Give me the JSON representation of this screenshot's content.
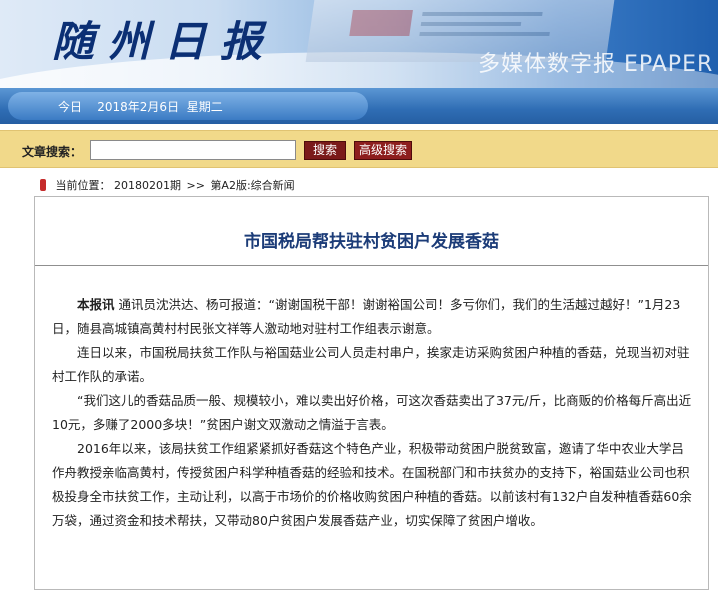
{
  "header": {
    "logo_text": "随州日报",
    "slogan": "多媒体数字报 EPAPER"
  },
  "datebar": {
    "date_text": "今日    2018年2月6日  星期二"
  },
  "search": {
    "label": "文章搜索：",
    "value": "",
    "placeholder": "",
    "search_button": "搜索",
    "advanced_button": "高级搜索"
  },
  "breadcrumb": {
    "prefix": "当前位置：",
    "issue": "20180201期",
    "separator": ">>",
    "section": "第A2版:综合新闻"
  },
  "article": {
    "title": "市国税局帮扶驻村贫困户发展香菇",
    "lead_label": "本报讯",
    "p1": " 通讯员沈洪达、杨可报道：“谢谢国税干部！谢谢裕国公司！多亏你们，我们的生活越过越好！”1月23日，随县高城镇高黄村村民张文祥等人激动地对驻村工作组表示谢意。",
    "p2": "连日以来，市国税局扶贫工作队与裕国菇业公司人员走村串户，挨家走访采购贫困户种植的香菇，兑现当初对驻村工作队的承诺。",
    "p3": "“我们这儿的香菇品质一般、规模较小，难以卖出好价格，可这次香菇卖出了37元/斤，比商贩的价格每斤高出近10元，多赚了2000多块！”贫困户谢文双激动之情溢于言表。",
    "p4": "2016年以来，该局扶贫工作组紧紧抓好香菇这个特色产业，积极带动贫困户脱贫致富，邀请了华中农业大学吕作舟教授亲临高黄村，传授贫困户科学种植香菇的经验和技术。在国税部门和市扶贫办的支持下，裕国菇业公司也积极投身全市扶贫工作，主动让利，以高于市场价的价格收购贫困户种植的香菇。以前该村有132户自发种植香菇60余万袋，通过资金和技术帮扶，又带动80户贫困户发展香菇产业，切实保障了贫困户增收。"
  },
  "colors": {
    "title_blue": "#1c3c78",
    "search_bar_bg": "#f1d98a",
    "button_dark_red": "#7a1a1a",
    "datebar_blue": "#2f6db4"
  }
}
